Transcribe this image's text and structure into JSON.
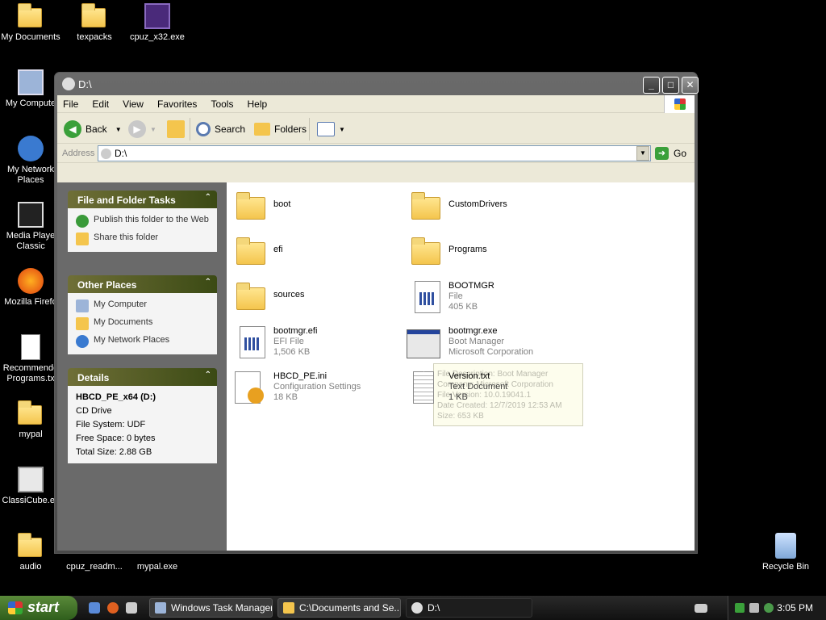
{
  "desktop": {
    "icons": [
      {
        "label": "My Documents"
      },
      {
        "label": "texpacks"
      },
      {
        "label": "cpuz_x32.exe"
      },
      {
        "label": "My Compute"
      },
      {
        "label": "My Network Places"
      },
      {
        "label": "Media Playe Classic"
      },
      {
        "label": "Mozilla Firefo"
      },
      {
        "label": "Recommende Programs.tx"
      },
      {
        "label": "mypal"
      },
      {
        "label": "ClassiCube.ex"
      },
      {
        "label": "audio"
      },
      {
        "label": "cpuz_readm..."
      },
      {
        "label": "mypal.exe"
      },
      {
        "label": "Recycle Bin"
      }
    ]
  },
  "window": {
    "title": "D:\\",
    "menu": [
      "File",
      "Edit",
      "View",
      "Favorites",
      "Tools",
      "Help"
    ],
    "toolbar": {
      "back": "Back",
      "search": "Search",
      "folders": "Folders"
    },
    "address": {
      "label": "Address",
      "value": "D:\\",
      "go": "Go"
    }
  },
  "taskpane": {
    "file_tasks": {
      "title": "File and Folder Tasks",
      "items": [
        "Publish this folder to the Web",
        "Share this folder"
      ]
    },
    "other_places": {
      "title": "Other Places",
      "items": [
        "My Computer",
        "My Documents",
        "My Network Places"
      ]
    },
    "details": {
      "title": "Details",
      "name": "HBCD_PE_x64 (D:)",
      "type": "CD Drive",
      "filesystem": "File System: UDF",
      "free": "Free Space: 0 bytes",
      "total": "Total Size: 2.88 GB"
    }
  },
  "files": [
    {
      "name": "boot"
    },
    {
      "name": "CustomDrivers"
    },
    {
      "name": "efi"
    },
    {
      "name": "Programs"
    },
    {
      "name": "sources"
    },
    {
      "name": "BOOTMGR",
      "type": "File",
      "size": "405 KB"
    },
    {
      "name": "bootmgr.efi",
      "type": "EFI File",
      "size": "1,506 KB"
    },
    {
      "name": "bootmgr.exe",
      "type": "Boot Manager",
      "size": "Microsoft Corporation"
    },
    {
      "name": "HBCD_PE.ini",
      "type": "Configuration Settings",
      "size": "18 KB"
    },
    {
      "name": "Version.txt",
      "type": "Text Document",
      "size": "1 KB"
    }
  ],
  "tooltip": {
    "lines": [
      "File Description: Boot Manager",
      "Company: Microsoft Corporation",
      "File Version: 10.0.19041.1",
      "Date Created: 12/7/2019 12:53 AM",
      "Size: 653 KB"
    ]
  },
  "taskbar": {
    "start": "start",
    "tasks": [
      "Windows Task Manager",
      "C:\\Documents and Se...",
      "D:\\"
    ],
    "clock": "3:05 PM"
  }
}
